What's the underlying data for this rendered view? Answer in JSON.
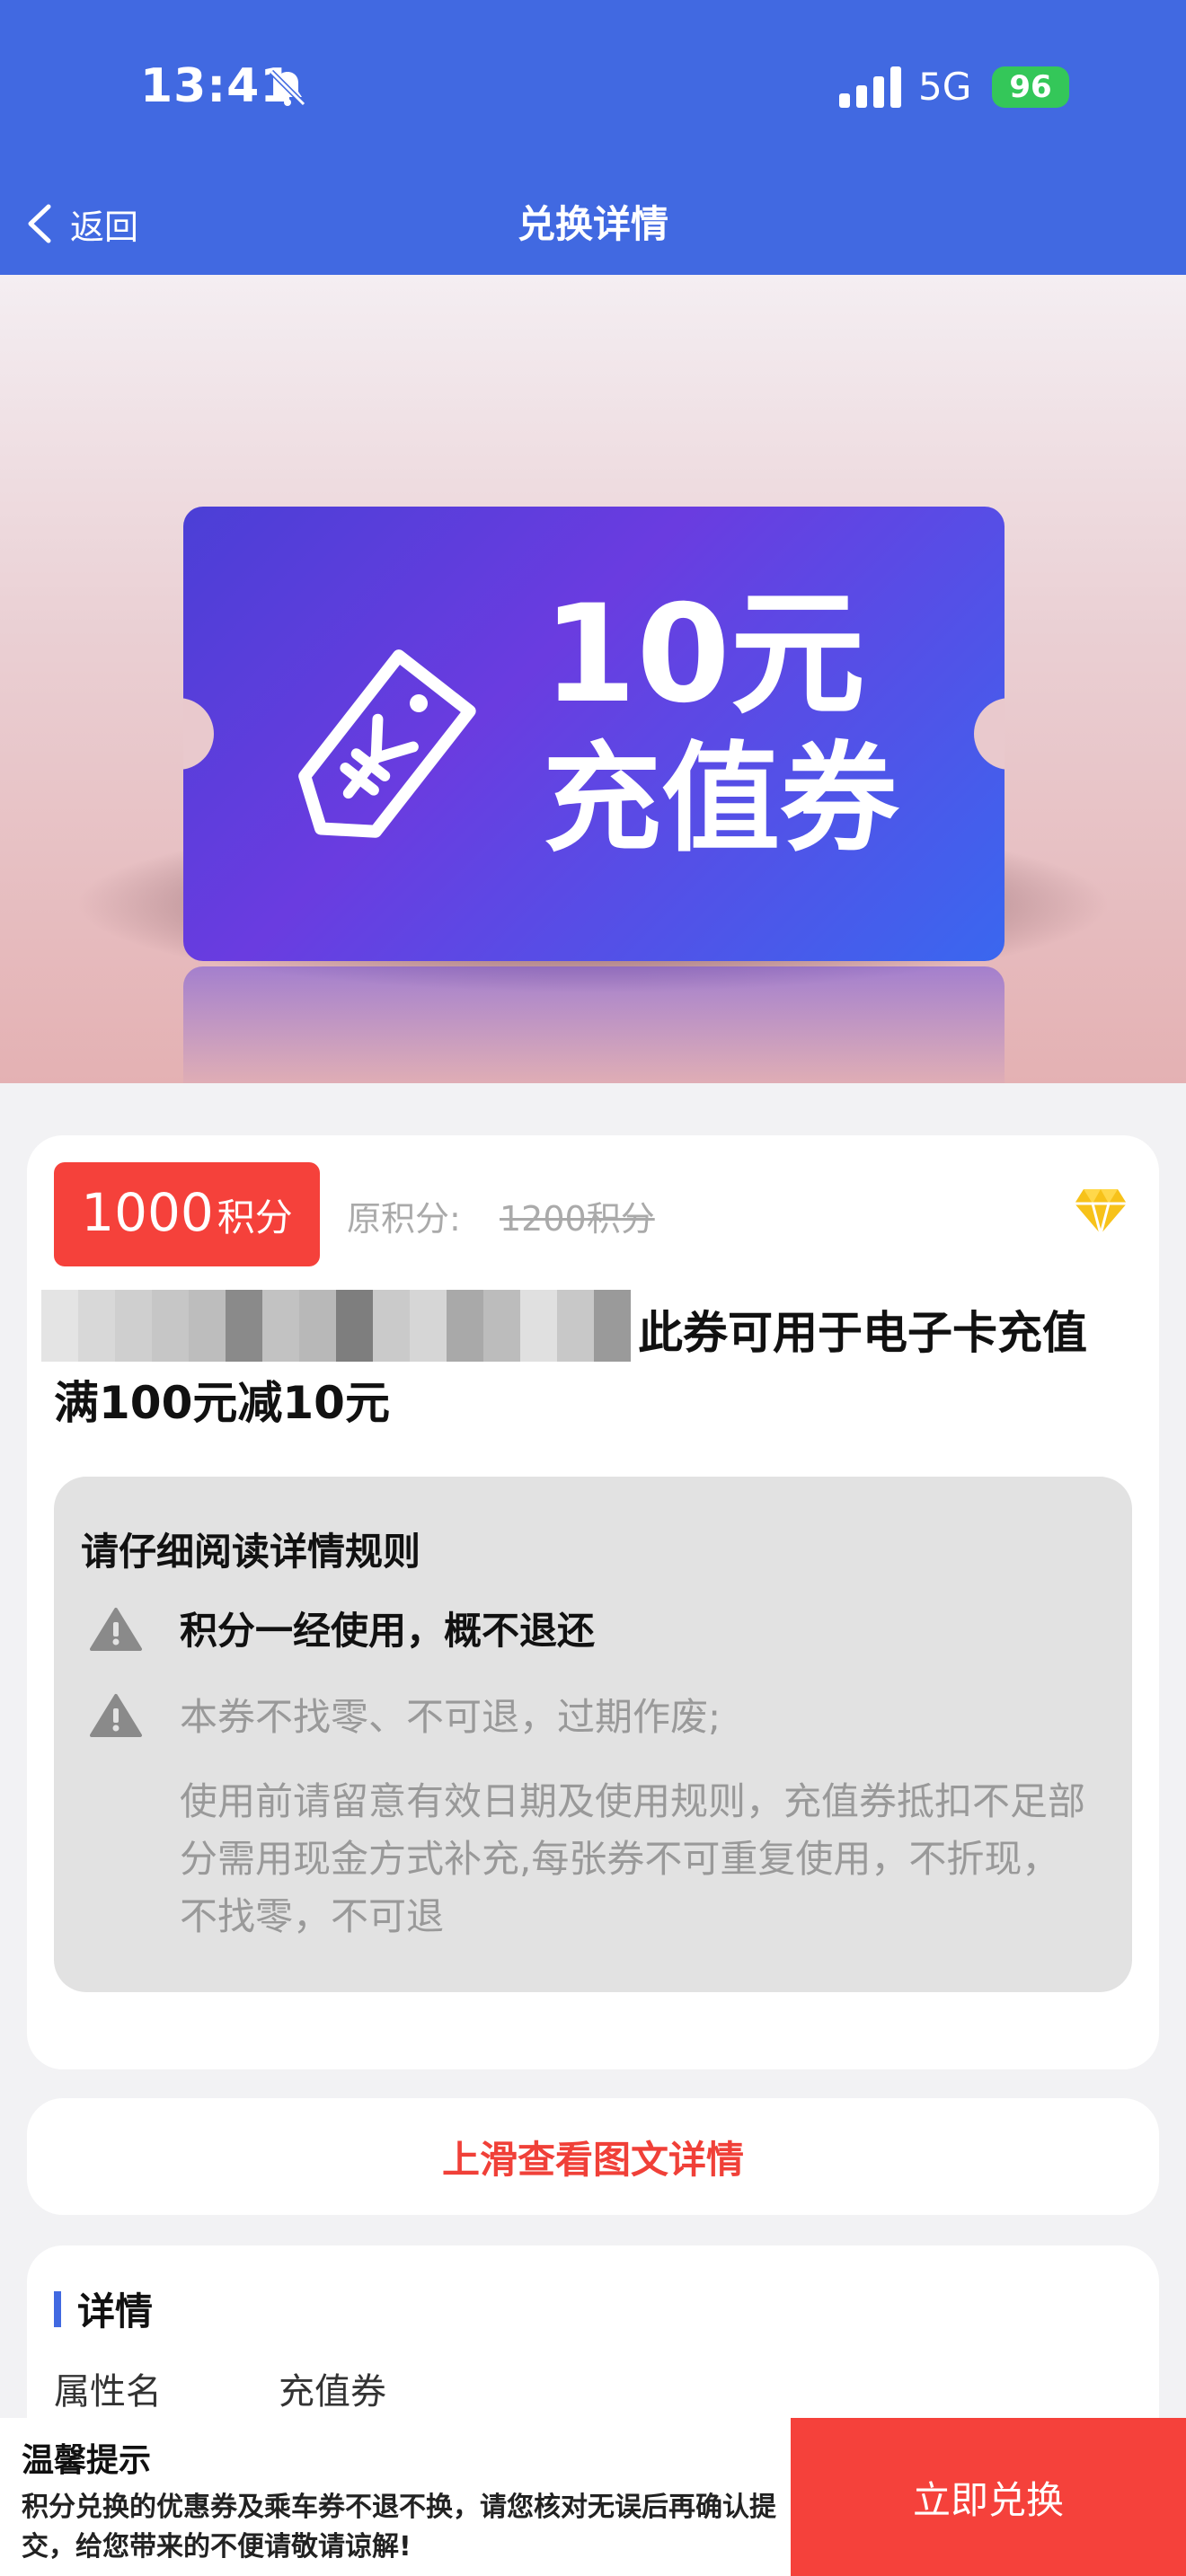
{
  "status_bar": {
    "time": "13:41",
    "network": "5G",
    "battery": "96"
  },
  "nav": {
    "back_label": "返回",
    "title": "兑换详情"
  },
  "hero": {
    "amount": "10元",
    "type": "充值券"
  },
  "product": {
    "price_value": "1000",
    "price_unit": "积分",
    "original_label": "原积分:",
    "original_value": "1200积分",
    "title_line1": "此券可用于电子卡充值",
    "title_line2": "满100元减10元"
  },
  "rules": {
    "heading": "请仔细阅读详情规则",
    "items": [
      "积分一经使用，概不退还",
      "本券不找零、不可退，过期作废;",
      "使用前请留意有效日期及使用规则，充值券抵扣不足部分需用现金方式补充,每张券不可重复使用，不折现，不找零，不可退"
    ]
  },
  "swipe_hint": "上滑查看图文详情",
  "detail": {
    "heading": "详情",
    "attr_name": "属性名",
    "attr_value": "充值券"
  },
  "bottom": {
    "tip_title": "温馨提示",
    "tip_body": "积分兑换的优惠券及乘车券不退不换，请您核对无误后再确认提交，给您带来的不便请敬请谅解!",
    "redeem_label": "立即兑换"
  },
  "colors": {
    "header": "#4169e1",
    "accent_red": "#f5413b",
    "swipe_red": "#f04038"
  }
}
